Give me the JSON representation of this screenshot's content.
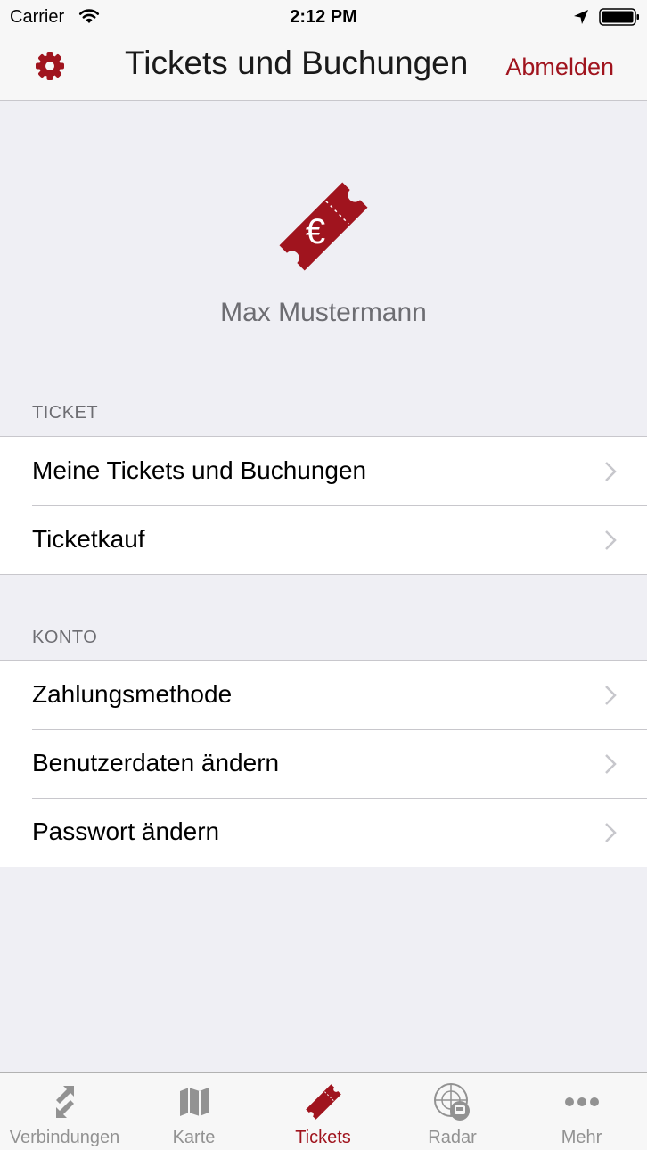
{
  "status_bar": {
    "carrier": "Carrier",
    "time": "2:12 PM"
  },
  "nav": {
    "title": "Tickets und Buchungen",
    "logout_label": "Abmelden",
    "settings_icon": "gear-icon"
  },
  "header": {
    "logo_icon": "ticket-euro-icon",
    "user_name": "Max Mustermann"
  },
  "sections": {
    "ticket": {
      "title": "TICKET",
      "items": [
        {
          "label": "Meine Tickets und Buchungen"
        },
        {
          "label": "Ticketkauf"
        }
      ]
    },
    "konto": {
      "title": "KONTO",
      "items": [
        {
          "label": "Zahlungsmethode"
        },
        {
          "label": "Benutzerdaten ändern"
        },
        {
          "label": "Passwort ändern"
        }
      ]
    }
  },
  "tab_bar": {
    "items": [
      {
        "label": "Verbindungen",
        "icon": "connections-icon",
        "active": false
      },
      {
        "label": "Karte",
        "icon": "map-icon",
        "active": false
      },
      {
        "label": "Tickets",
        "icon": "ticket-icon",
        "active": true
      },
      {
        "label": "Radar",
        "icon": "radar-icon",
        "active": false
      },
      {
        "label": "Mehr",
        "icon": "more-icon",
        "active": false
      }
    ]
  },
  "colors": {
    "accent": "#a0141e",
    "background": "#efeff4",
    "inactive_tab": "#929292"
  }
}
